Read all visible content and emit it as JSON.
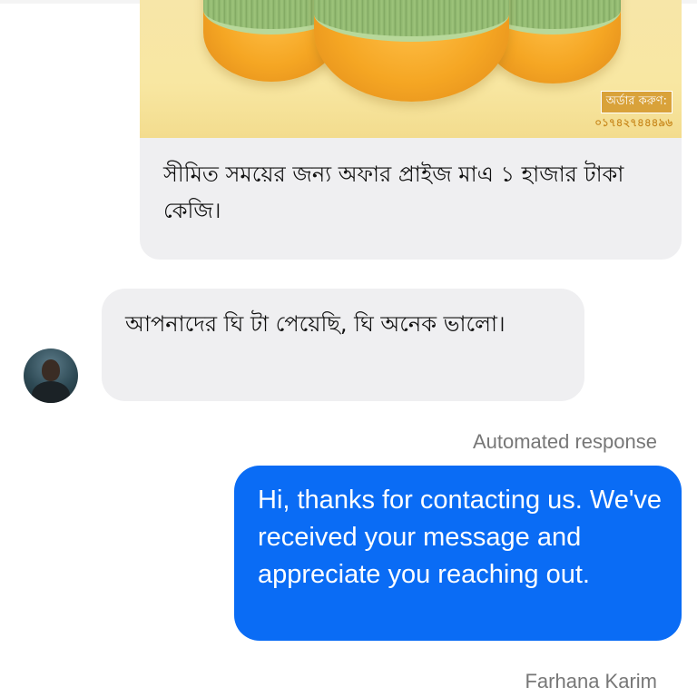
{
  "promo": {
    "order_label": "অর্ডার করুণ:",
    "order_phone": "০১৭৪২৭৪৪৪৯৬",
    "caption": "সীমিত সময়ের জন্য অফার প্রাইজ মাএ ১ হাজার টাকা কেজি।"
  },
  "incoming": {
    "text": "আপনাদের ঘি টা পেয়েছি, ঘি অনেক ভালো।"
  },
  "outgoing": {
    "meta_label": "Automated response",
    "text": "Hi, thanks for contacting us. We've received your message and appreciate you reaching out.",
    "sender": "Farhana Karim",
    "bubble_color": "#0a6cf5"
  }
}
